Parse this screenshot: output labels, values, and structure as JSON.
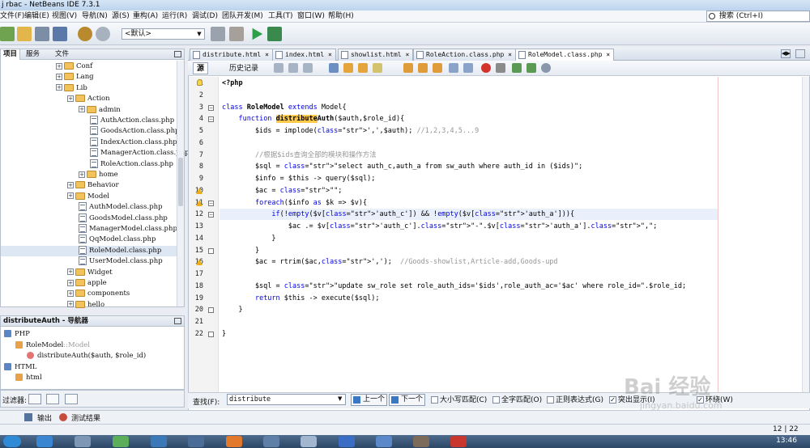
{
  "window": {
    "title": "j rbac - NetBeans IDE 7.3.1"
  },
  "menubar": {
    "items": [
      "文件(F)",
      "编辑(E)",
      "视图(V)",
      "导航(N)",
      "源(S)",
      "重构(A)",
      "运行(R)",
      "调试(D)",
      "团队开发(M)",
      "工具(T)",
      "窗口(W)",
      "帮助(H)"
    ]
  },
  "search": {
    "text": "搜索 (Ctrl+I)"
  },
  "toolbar": {
    "config": "<默认>"
  },
  "left_panel": {
    "tabs": [
      "项目",
      "服务",
      "文件"
    ],
    "tree": [
      {
        "label": "Conf",
        "type": "folder",
        "level": 2
      },
      {
        "label": "Lang",
        "type": "folder",
        "level": 2
      },
      {
        "label": "Lib",
        "type": "folder",
        "level": 2
      },
      {
        "label": "Action",
        "type": "folder",
        "level": 3
      },
      {
        "label": "admin",
        "type": "folder",
        "level": 4
      },
      {
        "label": "AuthAction.class.php",
        "type": "file",
        "level": 5
      },
      {
        "label": "GoodsAction.class.php",
        "type": "file",
        "level": 5
      },
      {
        "label": "IndexAction.class.php",
        "type": "file",
        "level": 5
      },
      {
        "label": "ManagerAction.class.php",
        "type": "file",
        "level": 5
      },
      {
        "label": "RoleAction.class.php",
        "type": "file",
        "level": 5
      },
      {
        "label": "home",
        "type": "folder",
        "level": 4
      },
      {
        "label": "Behavior",
        "type": "folder",
        "level": 3
      },
      {
        "label": "Model",
        "type": "folder",
        "level": 3
      },
      {
        "label": "AuthModel.class.php",
        "type": "file",
        "level": 4
      },
      {
        "label": "GoodsModel.class.php",
        "type": "file",
        "level": 4
      },
      {
        "label": "ManagerModel.class.php",
        "type": "file",
        "level": 4
      },
      {
        "label": "QqModel.class.php",
        "type": "file",
        "level": 4
      },
      {
        "label": "RoleModel.class.php",
        "type": "file",
        "level": 4
      },
      {
        "label": "UserModel.class.php",
        "type": "file",
        "level": 4
      },
      {
        "label": "Widget",
        "type": "folder",
        "level": 3
      },
      {
        "label": "apple",
        "type": "folder",
        "level": 3
      },
      {
        "label": "components",
        "type": "folder",
        "level": 3
      },
      {
        "label": "hello",
        "type": "folder",
        "level": 3
      }
    ]
  },
  "navigator": {
    "title": "distributeAuth - 导航器",
    "items": [
      {
        "label": "PHP",
        "level": 0
      },
      {
        "label": "RoleModel",
        "suffix": "::Model",
        "level": 1
      },
      {
        "label": "distributeAuth($auth, $role_id)",
        "level": 2
      },
      {
        "label": "HTML",
        "level": 0
      },
      {
        "label": "html",
        "level": 1
      }
    ],
    "filter_label": "过滤器:"
  },
  "editor": {
    "tabs": [
      "distribute.html",
      "index.html",
      "showlist.html",
      "RoleAction.class.php",
      "RoleModel.class.php"
    ],
    "view_tabs": [
      "源",
      "历史记录"
    ],
    "lines": [
      {
        "n": "1",
        "t": "<?php"
      },
      {
        "n": "2",
        "t": ""
      },
      {
        "n": "3",
        "t": "class RoleModel extends Model{"
      },
      {
        "n": "4",
        "t": "    function distributeAuth($auth,$role_id){"
      },
      {
        "n": "5",
        "t": "        $ids = implode(',',$auth); //1,2,3,4,5...9"
      },
      {
        "n": "6",
        "t": ""
      },
      {
        "n": "7",
        "t": "        //根据$ids查询全部的模块和操作方法"
      },
      {
        "n": "8",
        "t": "        $sql = \"select auth_c,auth_a from sw_auth where auth_id in ($ids)\";"
      },
      {
        "n": "9",
        "t": "        $info = $this -> query($sql);"
      },
      {
        "n": "10",
        "t": "        $ac = \"\";"
      },
      {
        "n": "11",
        "t": "        foreach($info as $k => $v){"
      },
      {
        "n": "12",
        "t": "            if(!empty($v['auth_c']) && !empty($v['auth_a'])){"
      },
      {
        "n": "13",
        "t": "                $ac .= $v['auth_c'].\"-\".$v['auth_a'].\",\";"
      },
      {
        "n": "14",
        "t": "            }"
      },
      {
        "n": "15",
        "t": "        }"
      },
      {
        "n": "16",
        "t": "        $ac = rtrim($ac,',');  //Goods-showlist,Article-add,Goods-upd"
      },
      {
        "n": "17",
        "t": ""
      },
      {
        "n": "18",
        "t": "        $sql = \"update sw_role set role_auth_ids='$ids',role_auth_ac='$ac' where role_id=\".$role_id;"
      },
      {
        "n": "19",
        "t": "        return $this -> execute($sql);"
      },
      {
        "n": "20",
        "t": "    }"
      },
      {
        "n": "21",
        "t": ""
      },
      {
        "n": "22",
        "t": "}"
      }
    ]
  },
  "findbar": {
    "label": "查找(F):",
    "value": "distribute",
    "prev": "上一个",
    "next": "下一个",
    "options": [
      "大小写匹配(C)",
      "全字匹配(O)",
      "正则表达式(G)",
      "突出显示(I)",
      "环绕(W)"
    ]
  },
  "outputbar": {
    "tabs": [
      "输出",
      "测试结果"
    ]
  },
  "statusbar": {
    "col": "12 | 22",
    "mode": "INS"
  },
  "taskbar": {
    "clock": "13:46"
  },
  "watermark": {
    "text": "Bai 经验",
    "url": "jingyan.baidu.com"
  }
}
